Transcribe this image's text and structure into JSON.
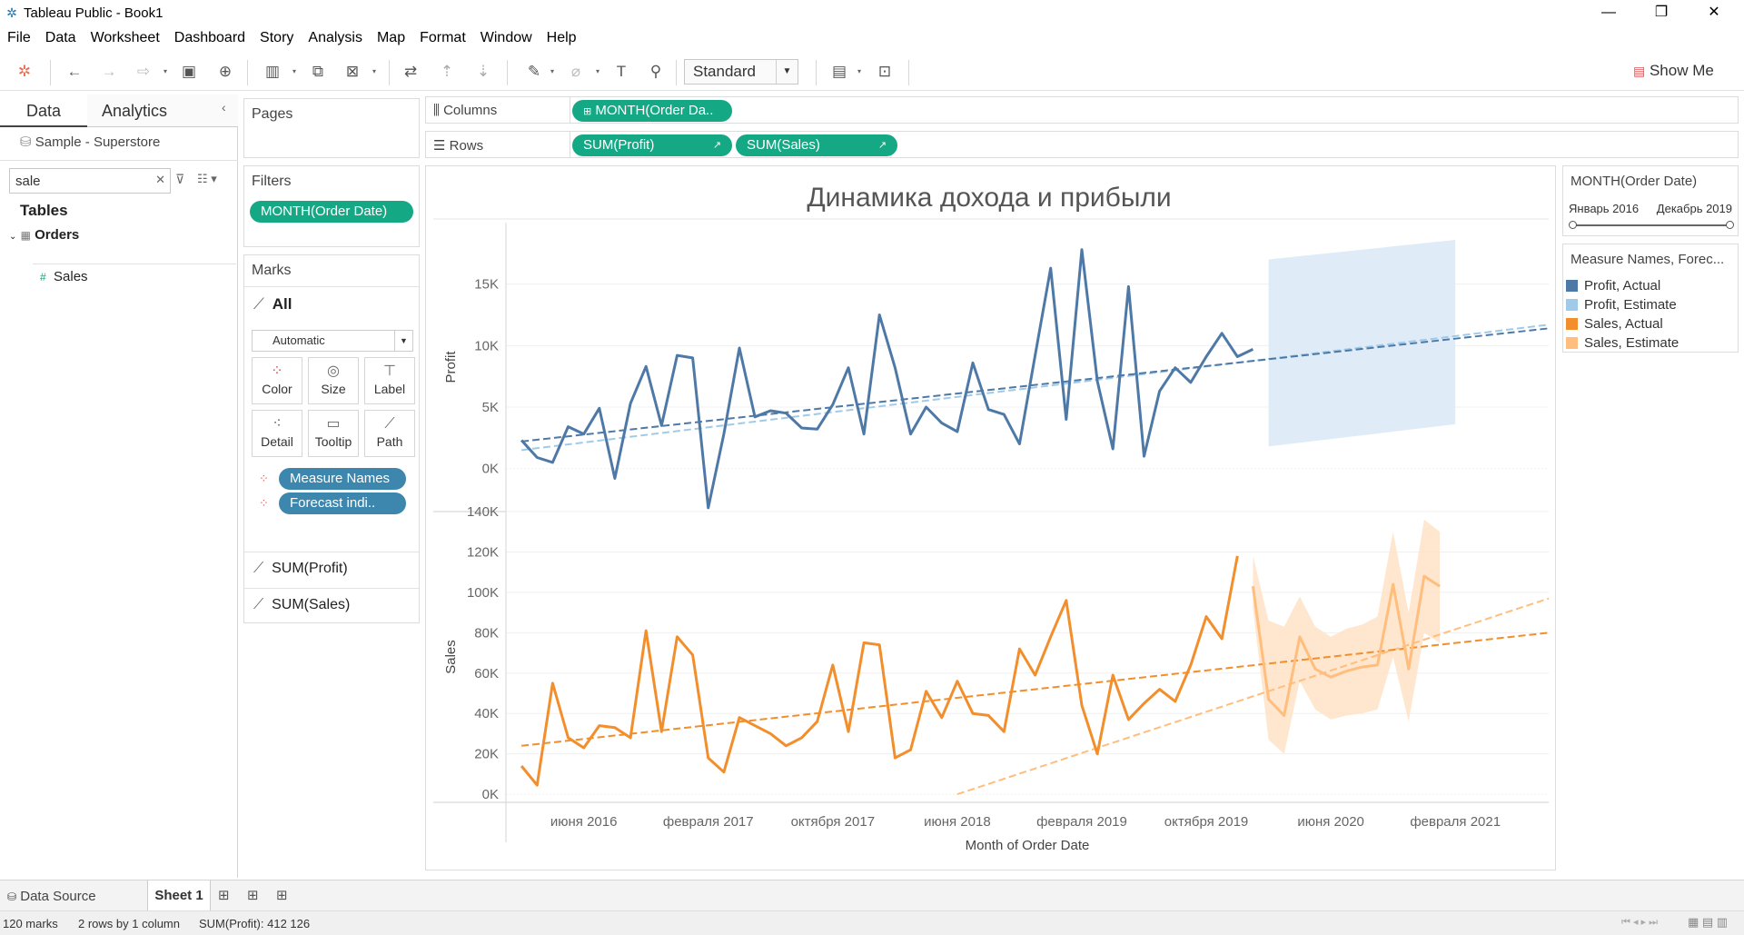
{
  "window": {
    "title": "Tableau Public - Book1"
  },
  "menu": [
    "File",
    "Data",
    "Worksheet",
    "Dashboard",
    "Story",
    "Analysis",
    "Map",
    "Format",
    "Window",
    "Help"
  ],
  "toolbar": {
    "fit": "Standard",
    "show_me": "Show Me"
  },
  "data_pane": {
    "tabs": [
      "Data",
      "Analytics"
    ],
    "datasource": "Sample - Superstore",
    "search": "sale",
    "tables_header": "Tables",
    "table": "Orders",
    "field": "Sales"
  },
  "shelves": {
    "pages": "Pages",
    "filters": "Filters",
    "filter_pill": "MONTH(Order Date)",
    "columns": "Columns",
    "columns_pill": "MONTH(Order Da..",
    "rows": "Rows",
    "rows_pills": [
      "SUM(Profit)",
      "SUM(Sales)"
    ]
  },
  "marks": {
    "title": "Marks",
    "all": "All",
    "mark_type": "Automatic",
    "buttons": [
      "Color",
      "Size",
      "Label",
      "Detail",
      "Tooltip",
      "Path"
    ],
    "pills": [
      "Measure Names",
      "Forecast indi.."
    ],
    "cards": [
      "SUM(Profit)",
      "SUM(Sales)"
    ]
  },
  "filter_card": {
    "title": "MONTH(Order Date)",
    "start": "Январь 2016",
    "end": "Декабрь 2019"
  },
  "legend": {
    "title": "Measure Names, Forec...",
    "items": [
      {
        "label": "Profit, Actual",
        "color": "#4e79a7"
      },
      {
        "label": "Profit, Estimate",
        "color": "#a0cbe8"
      },
      {
        "label": "Sales, Actual",
        "color": "#f28e2b"
      },
      {
        "label": "Sales, Estimate",
        "color": "#ffbe7d"
      }
    ]
  },
  "bottom": {
    "data_source": "Data Source",
    "sheet": "Sheet 1"
  },
  "status": {
    "marks": "120 marks",
    "rows": "2 rows by 1 column",
    "sum": "SUM(Profit): 412 126"
  },
  "chart_data": {
    "type": "line",
    "title": "Динамика дохода и прибыли",
    "xlabel": "Month of Order Date",
    "x_ticks": [
      "июня 2016",
      "февраля 2017",
      "октября 2017",
      "июня 2018",
      "февраля 2019",
      "октября 2019",
      "июня 2020",
      "февраля 2021"
    ],
    "panes": [
      {
        "ylabel": "Profit",
        "yticks": [
          "0K",
          "5K",
          "10K",
          "15K"
        ],
        "ylim": [
          -3500,
          20000
        ],
        "series": [
          {
            "name": "Profit, Actual",
            "color": "#4e79a7",
            "values": [
              2300,
              900,
              500,
              3400,
              2800,
              4900,
              -800,
              5300,
              8300,
              3500,
              9200,
              9000,
              -3200,
              2800,
              9800,
              4200,
              4700,
              4500,
              3300,
              3200,
              5200,
              8200,
              2800,
              12500,
              8200,
              2800,
              5000,
              3700,
              3000,
              8600,
              4800,
              4400,
              2000,
              9200,
              16300,
              4000,
              17800,
              7100,
              1600,
              14800,
              1000,
              6300,
              8200,
              7000,
              9100,
              11000,
              9100,
              9700
            ]
          },
          {
            "name": "Profit, Estimate",
            "color": "#a0cbe8",
            "values": []
          }
        ],
        "forecast_band": {
          "x_start": 48,
          "x_end": 60,
          "lower": [
            1800,
            3600
          ],
          "upper": [
            17000,
            18600
          ]
        },
        "trend": {
          "actual": [
            [
              0,
              2200
            ],
            [
              66,
              11400
            ]
          ],
          "estimate": [
            [
              0,
              1500
            ],
            [
              66,
              11700
            ]
          ]
        }
      },
      {
        "ylabel": "Sales",
        "yticks": [
          "0K",
          "20K",
          "40K",
          "60K",
          "80K",
          "100K",
          "120K",
          "140K"
        ],
        "ylim": [
          -4000,
          140000
        ],
        "series": [
          {
            "name": "Sales, Actual",
            "color": "#f28e2b",
            "values": [
              14000,
              4500,
              55000,
              28000,
              23000,
              34000,
              33000,
              28000,
              81000,
              31000,
              78000,
              69000,
              18000,
              11000,
              38000,
              34000,
              30000,
              24000,
              28000,
              36000,
              64000,
              31000,
              75000,
              74000,
              18000,
              22000,
              51000,
              38000,
              56000,
              40000,
              39000,
              31000,
              72000,
              59000,
              78000,
              96000,
              44000,
              20000,
              59000,
              37000,
              45000,
              52000,
              46000,
              64000,
              88000,
              77000,
              118000
            ]
          },
          {
            "name": "Sales, Estimate",
            "color": "#ffbe7d",
            "values": [
              103000,
              47000,
              39000,
              78000,
              62000,
              58000,
              61000,
              63000,
              64000,
              104000,
              62000,
              108000,
              103000
            ]
          }
        ],
        "forecast_band": {
          "x_start": 47,
          "lower": [
            92000,
            27000,
            20000,
            56000,
            42000,
            37000,
            39000,
            40000,
            42000,
            68000,
            36000,
            80000,
            75000
          ],
          "upper": [
            118000,
            86000,
            83000,
            98000,
            83000,
            78000,
            82000,
            84000,
            88000,
            130000,
            90000,
            136000,
            130000
          ]
        },
        "trend": {
          "actual": [
            [
              0,
              24000
            ],
            [
              66,
              80000
            ]
          ],
          "estimate": [
            [
              28,
              0
            ],
            [
              66,
              97000
            ]
          ]
        }
      }
    ]
  }
}
